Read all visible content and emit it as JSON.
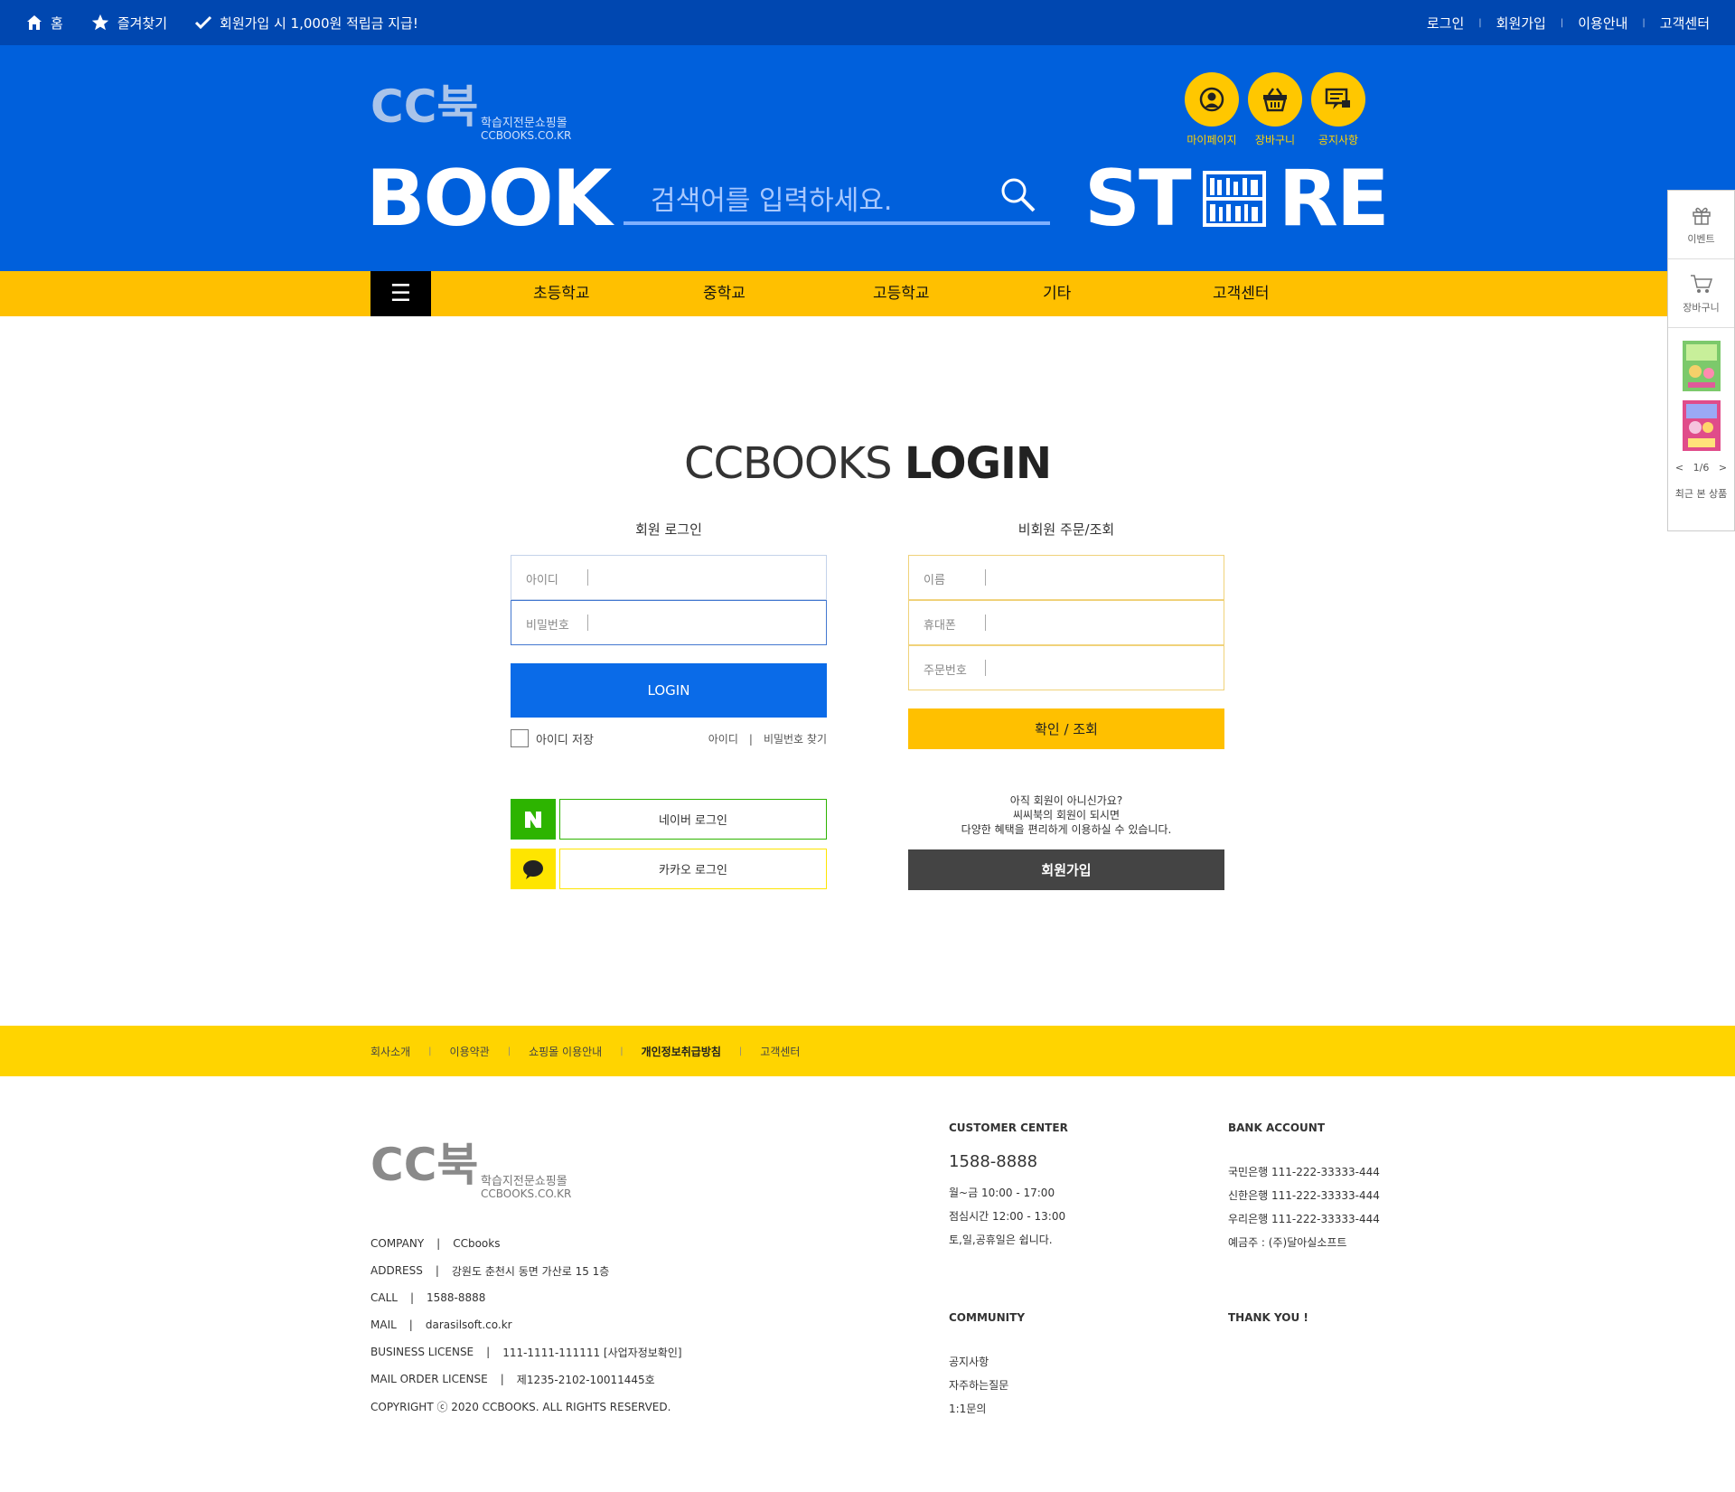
{
  "topbar": {
    "home": "홈",
    "favorite": "즐겨찾기",
    "promo": "회원가입 시 1,000원 적립금 지급!",
    "login": "로그인",
    "signup": "회원가입",
    "guide": "이용안내",
    "support": "고객센터"
  },
  "header": {
    "logo_text": "CC북",
    "logo_sub": "학습지전문쇼핑몰",
    "logo_url_text": "CCBOOKS.CO.KR",
    "book_word": "BOOK",
    "store_left": "ST",
    "store_right": "RE",
    "search_placeholder": "검색어를 입력하세요.",
    "quick": [
      {
        "label": "마이페이지",
        "icon": "user-icon"
      },
      {
        "label": "장바구니",
        "icon": "basket-icon"
      },
      {
        "label": "공지사항",
        "icon": "notice-icon"
      }
    ]
  },
  "gnb": {
    "menu_icon": "☰",
    "items": [
      "초등학교",
      "중학교",
      "고등학교",
      "기타",
      "고객센터"
    ]
  },
  "login": {
    "title_light": "CCBOOKS ",
    "title_bold": "LOGIN",
    "member_heading": "회원 로그인",
    "guest_heading": "비회원 주문/조회",
    "id_label": "아이디",
    "pw_label": "비밀번호",
    "login_button": "LOGIN",
    "save_id": "아이디 저장",
    "find_id": "아이디",
    "find_pw": "비밀번호 찾기",
    "naver_login": "네이버 로그인",
    "kakao_login": "카카오 로그인",
    "guest_name": "이름",
    "guest_phone": "휴대폰",
    "guest_order": "주문번호",
    "confirm_button": "확인 / 조회",
    "join_line1": "아직 회원이 아니신가요?",
    "join_line2": "씨씨북의 회원이 되시면",
    "join_line3": "다양한 혜택을 편리하게 이용하실 수 있습니다.",
    "join_button": "회원가입"
  },
  "footer_links": [
    "회사소개",
    "이용약관",
    "쇼핑몰 이용안내",
    "개인정보취급방침",
    "고객센터"
  ],
  "footer": {
    "company_label": "COMPANY",
    "company": "CCbooks",
    "address_label": "ADDRESS",
    "address": "강원도 춘천시 동면 가산로 15 1층",
    "call_label": "CALL",
    "call": "1588-8888",
    "mail_label": "MAIL",
    "mail": "darasilsoft.co.kr",
    "biz_label": "BUSINESS LICENSE",
    "biz": "111-1111-111111 [사업자정보확인]",
    "mo_label": "MAIL ORDER LICENSE",
    "mo": "제1235-2102-10011445호",
    "copyright": "COPYRIGHT ⓒ 2020 CCBOOKS. ALL RIGHTS RESERVED.",
    "cc_title": "CUSTOMER CENTER",
    "cc_phone": "1588-8888",
    "cc_hours": "월~금 10:00 - 17:00",
    "cc_lunch": "점심시간 12:00 - 13:00",
    "cc_off": "토,일,공휴일은 쉽니다.",
    "bank_title": "BANK ACCOUNT",
    "bank1": "국민은행 111-222-33333-444",
    "bank2": "신한은행 111-222-33333-444",
    "bank3": "우리은행 111-222-33333-444",
    "holder": "예금주 : (주)달아실소프트",
    "community_title": "COMMUNITY",
    "comm1": "공지사항",
    "comm2": "자주하는질문",
    "comm3": "1:1문의",
    "thanks": "THANK YOU !"
  },
  "side": {
    "event": "이벤트",
    "cart": "장바구니",
    "pager": "1/6",
    "recent": "최근 본 상품"
  },
  "colors": {
    "top_blue": "#0047b0",
    "header_blue": "#0060dc",
    "accent_yellow": "#ffc000",
    "footer_yellow": "#ffd400",
    "login_blue": "#0a6be8",
    "naver_green": "#2db400",
    "kakao_yellow": "#fee500"
  }
}
